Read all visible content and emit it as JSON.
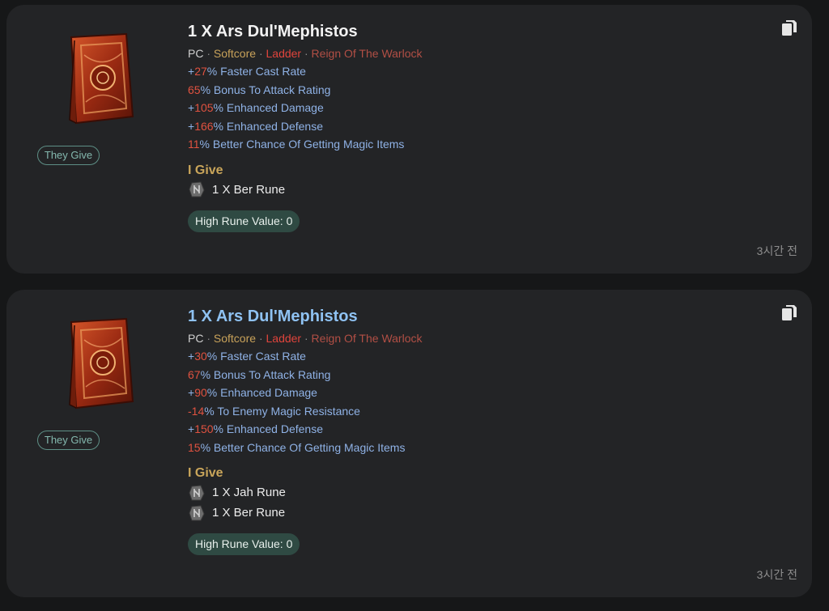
{
  "listings": [
    {
      "they_give_label": "They Give",
      "title": "1 X Ars Dul'Mephistos",
      "meta": {
        "platform": "PC",
        "sep": "·",
        "mode": "Softcore",
        "ladder": "Ladder",
        "season": "Reign Of The Warlock"
      },
      "stats": [
        {
          "prefix": "+",
          "num": "27",
          "text": "% Faster Cast Rate"
        },
        {
          "prefix": "",
          "num": "65",
          "text": "% Bonus To Attack Rating"
        },
        {
          "prefix": "+",
          "num": "105",
          "text": "% Enhanced Damage"
        },
        {
          "prefix": "+",
          "num": "166",
          "text": "% Enhanced Defense"
        },
        {
          "prefix": "",
          "num": "11",
          "text": "% Better Chance Of Getting Magic Items"
        }
      ],
      "i_give_label": "I Give",
      "runes": [
        {
          "label": "1 X Ber Rune",
          "icon": "rune-icon"
        }
      ],
      "high_rune_value": "High Rune Value: 0",
      "time": "3시간 전"
    },
    {
      "they_give_label": "They Give",
      "title": "1 X Ars Dul'Mephistos",
      "meta": {
        "platform": "PC",
        "sep": "·",
        "mode": "Softcore",
        "ladder": "Ladder",
        "season": "Reign Of The Warlock"
      },
      "stats": [
        {
          "prefix": "+",
          "num": "30",
          "text": "% Faster Cast Rate"
        },
        {
          "prefix": "",
          "num": "67",
          "text": "% Bonus To Attack Rating"
        },
        {
          "prefix": "+",
          "num": "90",
          "text": "% Enhanced Damage"
        },
        {
          "prefix": "",
          "num": "-14",
          "text": "% To Enemy Magic Resistance"
        },
        {
          "prefix": "+",
          "num": "150",
          "text": "% Enhanced Defense"
        },
        {
          "prefix": "",
          "num": "15",
          "text": "% Better Chance Of Getting Magic Items"
        }
      ],
      "i_give_label": "I Give",
      "runes": [
        {
          "label": "1 X Jah Rune",
          "icon": "rune-icon"
        },
        {
          "label": "1 X Ber Rune",
          "icon": "rune-icon"
        }
      ],
      "high_rune_value": "High Rune Value: 0",
      "time": "3시간 전"
    }
  ]
}
